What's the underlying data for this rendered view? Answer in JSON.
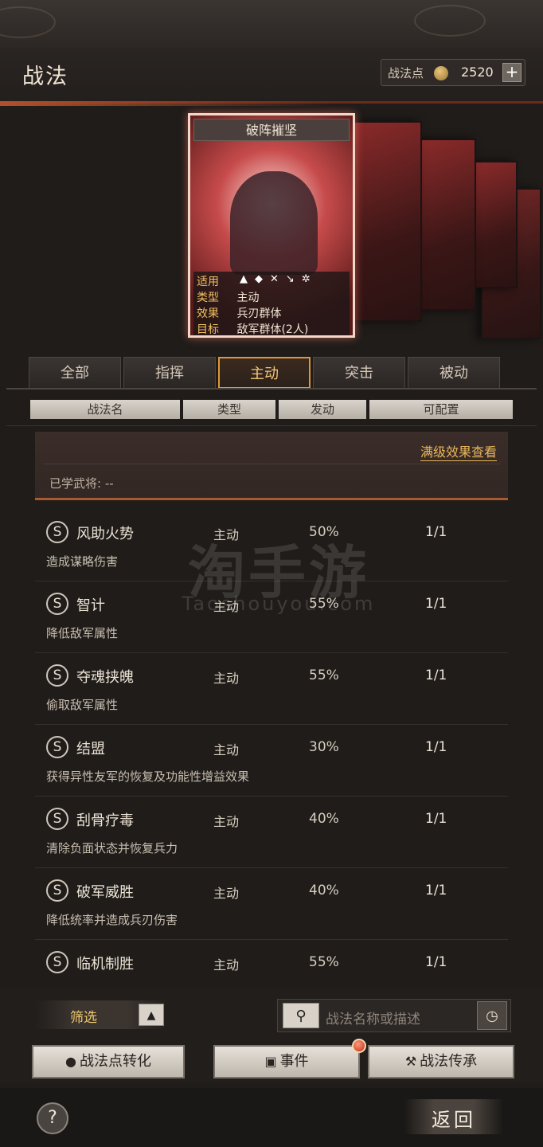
{
  "header": {
    "title": "战法",
    "points_label": "战法点",
    "points_icon": "coin-icon",
    "points_value": "2520",
    "add_label": "+"
  },
  "card": {
    "title": "破阵摧坚",
    "rows": [
      {
        "key": "适用",
        "value": ""
      },
      {
        "key": "类型",
        "value": "主动"
      },
      {
        "key": "效果",
        "value": "兵刃群体"
      },
      {
        "key": "目标",
        "value": "敌军群体(2人)"
      }
    ],
    "troop_icons": [
      "cavalry-icon",
      "shield-icon",
      "bow-icon",
      "spear-icon",
      "wheel-icon"
    ]
  },
  "tabs": [
    {
      "label": "全部",
      "active": false
    },
    {
      "label": "指挥",
      "active": false
    },
    {
      "label": "主动",
      "active": true
    },
    {
      "label": "突击",
      "active": false
    },
    {
      "label": "被动",
      "active": false
    }
  ],
  "columns": [
    "战法名",
    "类型",
    "发动",
    "可配置"
  ],
  "detail": {
    "link": "满级效果查看",
    "learned": "已学武将: --"
  },
  "skills": [
    {
      "grade": "S",
      "name": "风助火势",
      "type": "主动",
      "rate": "50%",
      "config": "1/1",
      "desc": "造成谋略伤害"
    },
    {
      "grade": "S",
      "name": "智计",
      "type": "主动",
      "rate": "55%",
      "config": "1/1",
      "desc": "降低敌军属性"
    },
    {
      "grade": "S",
      "name": "夺魂挟魄",
      "type": "主动",
      "rate": "55%",
      "config": "1/1",
      "desc": "偷取敌军属性"
    },
    {
      "grade": "S",
      "name": "结盟",
      "type": "主动",
      "rate": "30%",
      "config": "1/1",
      "desc": "获得异性友军的恢复及功能性增益效果"
    },
    {
      "grade": "S",
      "name": "刮骨疗毒",
      "type": "主动",
      "rate": "40%",
      "config": "1/1",
      "desc": "清除负面状态并恢复兵力"
    },
    {
      "grade": "S",
      "name": "破军威胜",
      "type": "主动",
      "rate": "40%",
      "config": "1/1",
      "desc": "降低统率并造成兵刃伤害"
    },
    {
      "grade": "S",
      "name": "临机制胜",
      "type": "主动",
      "rate": "55%",
      "config": "1/1",
      "desc": ""
    }
  ],
  "watermark": {
    "main": "淘手游",
    "sub": "Taoshouyou.com"
  },
  "bottom": {
    "filter_label": "筛选",
    "filter_toggle": "▲",
    "search_placeholder": "战法名称或描述",
    "convert_label": "战法点转化",
    "event_label": "事件",
    "inherit_label": "战法传承"
  },
  "footer": {
    "help_label": "?",
    "back_label": "返回"
  }
}
